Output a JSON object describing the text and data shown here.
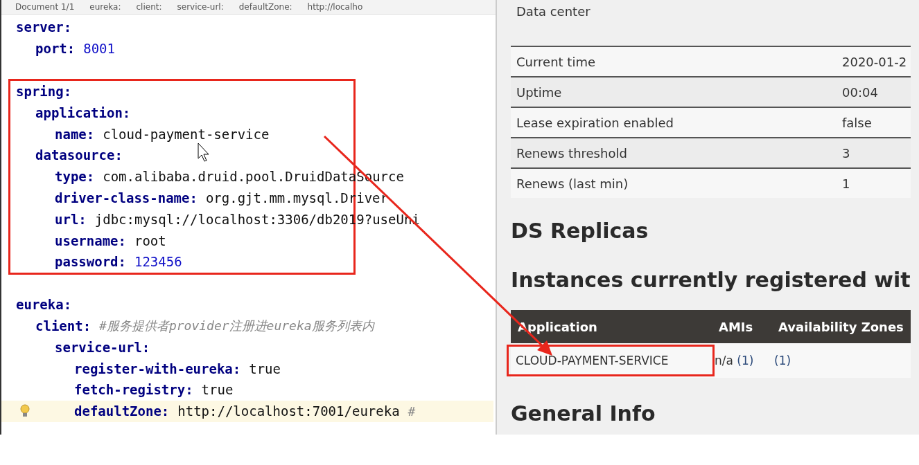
{
  "breadcrumb": [
    "Document 1/1",
    "eureka:",
    "client:",
    "service-url:",
    "defaultZone:",
    "http://localho"
  ],
  "code": [
    {
      "key": "server:",
      "boxed": false,
      "children": [
        {
          "key": "port:",
          "value": "8001",
          "kind": "number"
        }
      ]
    },
    {
      "key": "spring:",
      "boxed": true,
      "children": [
        {
          "key": "application:",
          "children": [
            {
              "key": "name:",
              "value": "cloud-payment-service",
              "kind": "string"
            }
          ]
        },
        {
          "key": "datasource:",
          "children": [
            {
              "key": "type:",
              "value": "com.alibaba.druid.pool.DruidDataSource",
              "kind": "string"
            },
            {
              "key": "driver-class-name:",
              "value": "org.gjt.mm.mysql.Driver",
              "kind": "string"
            },
            {
              "key": "url:",
              "value": "jdbc:mysql://localhost:3306/db2019?useUni",
              "kind": "string"
            },
            {
              "key": "username:",
              "value": "root",
              "kind": "string"
            },
            {
              "key": "password:",
              "value": "123456",
              "kind": "number"
            }
          ]
        }
      ]
    },
    {
      "key": "eureka:",
      "boxed": false,
      "children": [
        {
          "key": "client:",
          "value": "#服务提供者provider注册进eureka服务列表内",
          "kind": "comment",
          "children": [
            {
              "key": "service-url:",
              "children": [
                {
                  "key": "register-with-eureka:",
                  "value": "true",
                  "kind": "string"
                },
                {
                  "key": "fetch-registry:",
                  "value": "true",
                  "kind": "string"
                },
                {
                  "key": "defaultZone:",
                  "value": "http://localhost:7001/eureka",
                  "kind": "string",
                  "comment": "#",
                  "highlighted": true
                }
              ]
            }
          ]
        }
      ]
    }
  ],
  "status": {
    "top_label": "Data center",
    "rows": [
      {
        "label": "Current time",
        "value": "2020-01-2"
      },
      {
        "label": "Uptime",
        "value": "00:04"
      },
      {
        "label": "Lease expiration enabled",
        "value": "false"
      },
      {
        "label": "Renews threshold",
        "value": "3"
      },
      {
        "label": "Renews (last min)",
        "value": "1"
      }
    ]
  },
  "replicas_heading": "DS Replicas",
  "instances_heading": "Instances currently registered wit",
  "instances": {
    "columns": [
      "Application",
      "AMIs",
      "Availability Zones"
    ],
    "rows": [
      {
        "application": "CLOUD-PAYMENT-SERVICE",
        "amis": "n/a",
        "amis_count": "(1)",
        "zones": "(1)",
        "boxed": true
      }
    ]
  },
  "general_heading": "General Info"
}
